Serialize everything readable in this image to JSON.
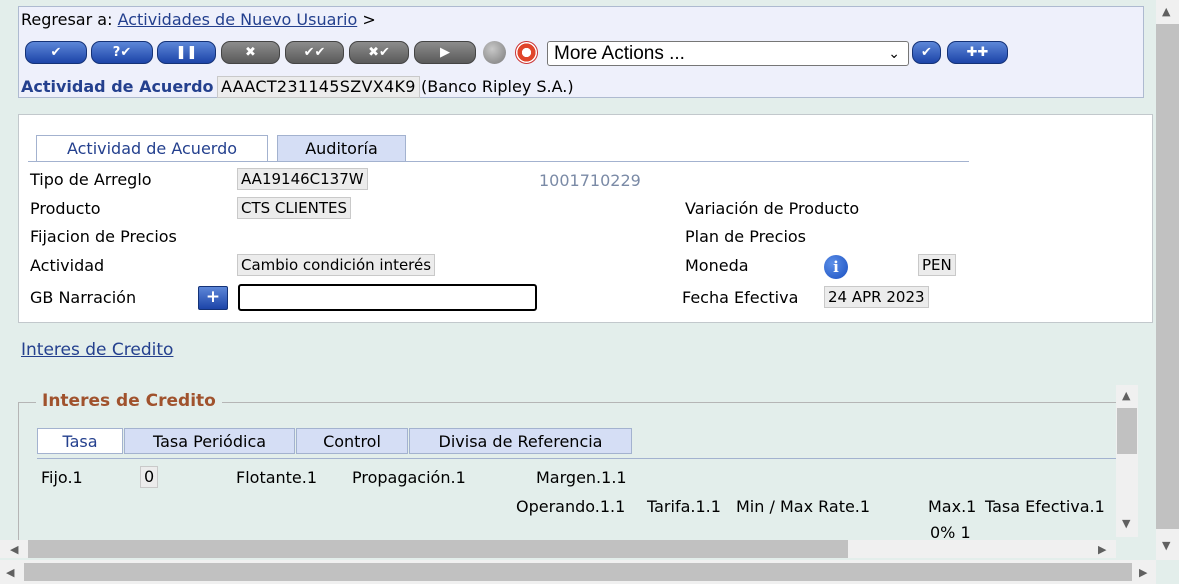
{
  "header": {
    "back_label": "Regresar a:",
    "back_link": "Actividades de Nuevo Usuario",
    "back_suffix": ">",
    "toolbar": {
      "b1": "✔",
      "b2": "?✔",
      "b3": "❚❚",
      "b4": "✖",
      "b5": "✔✔",
      "b6": "✖✔",
      "b7": "▶",
      "more_actions": "More Actions ...",
      "go": "✔",
      "add": "✚✚"
    },
    "activity_label": "Actividad de Acuerdo",
    "activity_id": "AAACT231145SZVX4K9",
    "bank": "(Banco Ripley S.A.)"
  },
  "form": {
    "tabs": [
      "Actividad de Acuerdo",
      "Auditoría"
    ],
    "tipo_label": "Tipo de Arreglo",
    "tipo_value": "AA19146C137W",
    "ref_number": "1001710229",
    "producto_label": "Producto",
    "producto_value": "CTS CLIENTES",
    "variacion_label": "Variación de Producto",
    "fijacion_label": "Fijacion de Precios",
    "plan_label": "Plan de Precios",
    "actividad_label": "Actividad",
    "actividad_value": "Cambio condición interés",
    "moneda_label": "Moneda",
    "moneda_value": "PEN",
    "info_glyph": "i",
    "narracion_label": "GB Narración",
    "add_glyph": "+",
    "fecha_label": "Fecha Efectiva",
    "fecha_value": "24 APR 2023"
  },
  "credit_link": "Interes de Credito",
  "section": {
    "title": "Interes de Credito",
    "tabs": [
      "Tasa",
      "Tasa Periódica",
      "Control",
      "Divisa de Referencia"
    ],
    "fijo_label": "Fijo.1",
    "fijo_value": "0",
    "flotante_label": "Flotante.1",
    "propagacion_label": "Propagación.1",
    "margen_label": "Margen.1.1",
    "operando_label": "Operando.1.1",
    "tarifa_label": "Tarifa.1.1",
    "minmax_label": "Min / Max Rate.1",
    "max_label": "Max.1",
    "tasa_efectiva_label": "Tasa Efectiva.1",
    "pct_value": "0% 1"
  },
  "colors": {
    "accent": "#24408e",
    "section_title": "#a0522d",
    "background": "#e3eeeb"
  }
}
